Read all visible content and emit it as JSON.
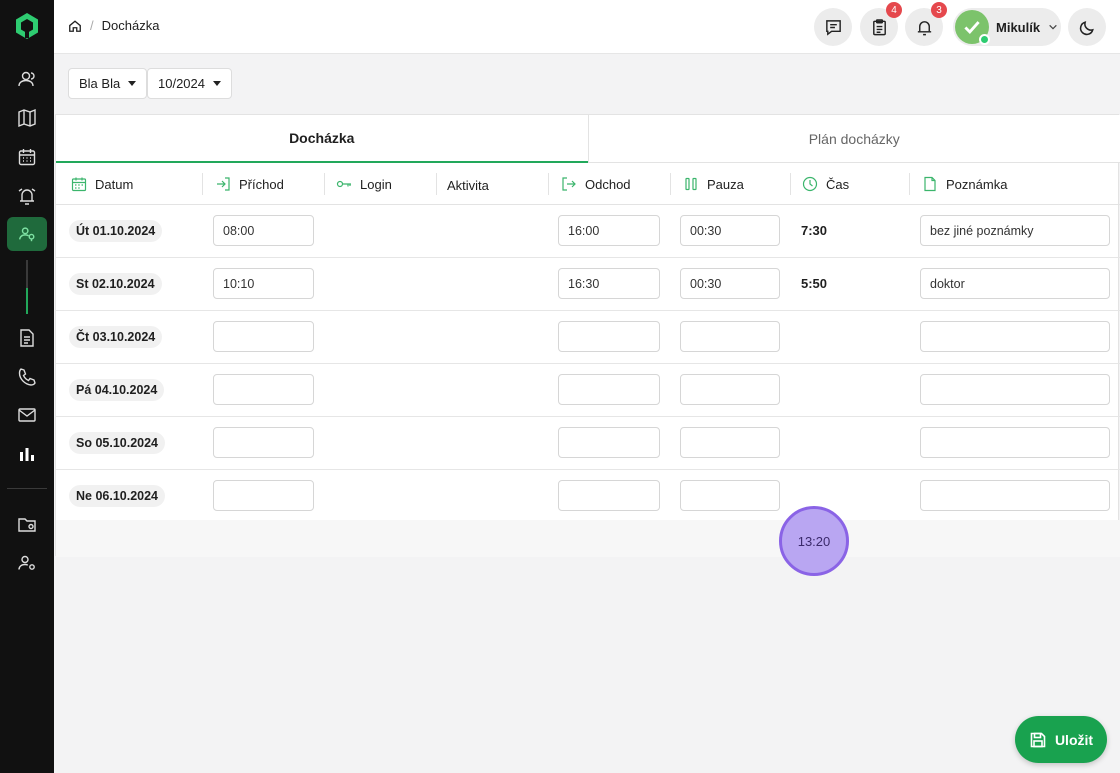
{
  "breadcrumb": {
    "current": "Docházka"
  },
  "header": {
    "clipboard_badge": "4",
    "bell_badge": "3",
    "user_name": "Mikulík"
  },
  "filters": {
    "person": "Bla Bla",
    "month": "10/2024"
  },
  "tabs": [
    {
      "label": "Docházka",
      "active": true
    },
    {
      "label": "Plán docházky",
      "active": false
    }
  ],
  "columns": {
    "datum": "Datum",
    "prichod": "Příchod",
    "login": "Login",
    "aktivita": "Aktivita",
    "odchod": "Odchod",
    "pauza": "Pauza",
    "cas": "Čas",
    "poznamka": "Poznámka"
  },
  "rows": [
    {
      "date": "Út 01.10.2024",
      "prichod": "08:00",
      "odchod": "16:00",
      "pauza": "00:30",
      "cas": "7:30",
      "poznamka": "bez jiné poznámky"
    },
    {
      "date": "St 02.10.2024",
      "prichod": "10:10",
      "odchod": "16:30",
      "pauza": "00:30",
      "cas": "5:50",
      "poznamka": "doktor"
    },
    {
      "date": "Čt 03.10.2024",
      "prichod": "",
      "odchod": "",
      "pauza": "",
      "cas": "",
      "poznamka": ""
    },
    {
      "date": "Pá 04.10.2024",
      "prichod": "",
      "odchod": "",
      "pauza": "",
      "cas": "",
      "poznamka": ""
    },
    {
      "date": "So 05.10.2024",
      "prichod": "",
      "odchod": "",
      "pauza": "",
      "cas": "",
      "poznamka": ""
    },
    {
      "date": "Ne 06.10.2024",
      "prichod": "",
      "odchod": "",
      "pauza": "",
      "cas": "",
      "poznamka": ""
    }
  ],
  "total": "13:20",
  "save_label": "Uložit",
  "colors": {
    "accent": "#19a24f",
    "sidebar": "#111111",
    "bubble": "#b9a6f2"
  }
}
